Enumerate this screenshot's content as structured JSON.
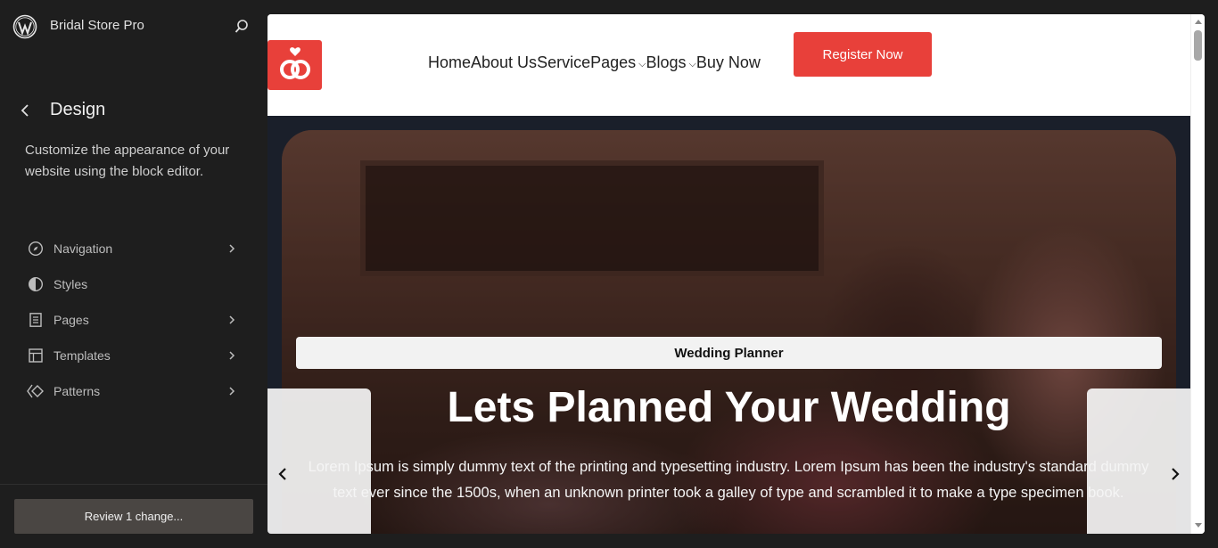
{
  "app": {
    "site_title": "Bridal Store Pro",
    "icons": {
      "wordpress": "wordpress-logo-icon",
      "search": "search-icon",
      "back": "chevron-left-icon"
    }
  },
  "sidebar": {
    "title": "Design",
    "description": "Customize the appearance of your website using the block editor.",
    "items": [
      {
        "label": "Navigation",
        "icon": "compass-icon",
        "has_chevron": true
      },
      {
        "label": "Styles",
        "icon": "half-circle-icon",
        "has_chevron": false
      },
      {
        "label": "Pages",
        "icon": "page-icon",
        "has_chevron": true
      },
      {
        "label": "Templates",
        "icon": "layout-icon",
        "has_chevron": true
      },
      {
        "label": "Patterns",
        "icon": "diamond-icon",
        "has_chevron": true
      }
    ],
    "review_label": "Review 1 change..."
  },
  "site": {
    "nav": [
      "Home",
      "About Us",
      "Service",
      "Pages",
      "Blogs",
      "Buy Now"
    ],
    "register_label": "Register Now",
    "hero": {
      "tag": "Wedding Planner",
      "title": "Lets Planned Your Wedding",
      "text": "Lorem Ipsum is simply dummy text of the printing and typesetting industry. Lorem Ipsum has been the industry's standard dummy text ever since the 1500s, when an unknown printer took a galley of type and scrambled it to make a type specimen book."
    }
  },
  "colors": {
    "accent": "#e8403a",
    "sidebar_bg": "#1e1e1e",
    "review_bg": "#4a4643"
  }
}
